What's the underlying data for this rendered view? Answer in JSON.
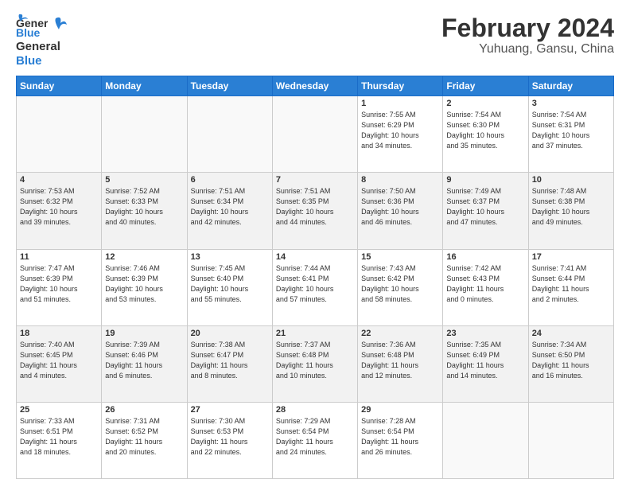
{
  "header": {
    "logo_general": "General",
    "logo_blue": "Blue",
    "main_title": "February 2024",
    "sub_title": "Yuhuang, Gansu, China"
  },
  "weekdays": [
    "Sunday",
    "Monday",
    "Tuesday",
    "Wednesday",
    "Thursday",
    "Friday",
    "Saturday"
  ],
  "weeks": [
    [
      {
        "day": "",
        "info": ""
      },
      {
        "day": "",
        "info": ""
      },
      {
        "day": "",
        "info": ""
      },
      {
        "day": "",
        "info": ""
      },
      {
        "day": "1",
        "info": "Sunrise: 7:55 AM\nSunset: 6:29 PM\nDaylight: 10 hours\nand 34 minutes."
      },
      {
        "day": "2",
        "info": "Sunrise: 7:54 AM\nSunset: 6:30 PM\nDaylight: 10 hours\nand 35 minutes."
      },
      {
        "day": "3",
        "info": "Sunrise: 7:54 AM\nSunset: 6:31 PM\nDaylight: 10 hours\nand 37 minutes."
      }
    ],
    [
      {
        "day": "4",
        "info": "Sunrise: 7:53 AM\nSunset: 6:32 PM\nDaylight: 10 hours\nand 39 minutes."
      },
      {
        "day": "5",
        "info": "Sunrise: 7:52 AM\nSunset: 6:33 PM\nDaylight: 10 hours\nand 40 minutes."
      },
      {
        "day": "6",
        "info": "Sunrise: 7:51 AM\nSunset: 6:34 PM\nDaylight: 10 hours\nand 42 minutes."
      },
      {
        "day": "7",
        "info": "Sunrise: 7:51 AM\nSunset: 6:35 PM\nDaylight: 10 hours\nand 44 minutes."
      },
      {
        "day": "8",
        "info": "Sunrise: 7:50 AM\nSunset: 6:36 PM\nDaylight: 10 hours\nand 46 minutes."
      },
      {
        "day": "9",
        "info": "Sunrise: 7:49 AM\nSunset: 6:37 PM\nDaylight: 10 hours\nand 47 minutes."
      },
      {
        "day": "10",
        "info": "Sunrise: 7:48 AM\nSunset: 6:38 PM\nDaylight: 10 hours\nand 49 minutes."
      }
    ],
    [
      {
        "day": "11",
        "info": "Sunrise: 7:47 AM\nSunset: 6:39 PM\nDaylight: 10 hours\nand 51 minutes."
      },
      {
        "day": "12",
        "info": "Sunrise: 7:46 AM\nSunset: 6:39 PM\nDaylight: 10 hours\nand 53 minutes."
      },
      {
        "day": "13",
        "info": "Sunrise: 7:45 AM\nSunset: 6:40 PM\nDaylight: 10 hours\nand 55 minutes."
      },
      {
        "day": "14",
        "info": "Sunrise: 7:44 AM\nSunset: 6:41 PM\nDaylight: 10 hours\nand 57 minutes."
      },
      {
        "day": "15",
        "info": "Sunrise: 7:43 AM\nSunset: 6:42 PM\nDaylight: 10 hours\nand 58 minutes."
      },
      {
        "day": "16",
        "info": "Sunrise: 7:42 AM\nSunset: 6:43 PM\nDaylight: 11 hours\nand 0 minutes."
      },
      {
        "day": "17",
        "info": "Sunrise: 7:41 AM\nSunset: 6:44 PM\nDaylight: 11 hours\nand 2 minutes."
      }
    ],
    [
      {
        "day": "18",
        "info": "Sunrise: 7:40 AM\nSunset: 6:45 PM\nDaylight: 11 hours\nand 4 minutes."
      },
      {
        "day": "19",
        "info": "Sunrise: 7:39 AM\nSunset: 6:46 PM\nDaylight: 11 hours\nand 6 minutes."
      },
      {
        "day": "20",
        "info": "Sunrise: 7:38 AM\nSunset: 6:47 PM\nDaylight: 11 hours\nand 8 minutes."
      },
      {
        "day": "21",
        "info": "Sunrise: 7:37 AM\nSunset: 6:48 PM\nDaylight: 11 hours\nand 10 minutes."
      },
      {
        "day": "22",
        "info": "Sunrise: 7:36 AM\nSunset: 6:48 PM\nDaylight: 11 hours\nand 12 minutes."
      },
      {
        "day": "23",
        "info": "Sunrise: 7:35 AM\nSunset: 6:49 PM\nDaylight: 11 hours\nand 14 minutes."
      },
      {
        "day": "24",
        "info": "Sunrise: 7:34 AM\nSunset: 6:50 PM\nDaylight: 11 hours\nand 16 minutes."
      }
    ],
    [
      {
        "day": "25",
        "info": "Sunrise: 7:33 AM\nSunset: 6:51 PM\nDaylight: 11 hours\nand 18 minutes."
      },
      {
        "day": "26",
        "info": "Sunrise: 7:31 AM\nSunset: 6:52 PM\nDaylight: 11 hours\nand 20 minutes."
      },
      {
        "day": "27",
        "info": "Sunrise: 7:30 AM\nSunset: 6:53 PM\nDaylight: 11 hours\nand 22 minutes."
      },
      {
        "day": "28",
        "info": "Sunrise: 7:29 AM\nSunset: 6:54 PM\nDaylight: 11 hours\nand 24 minutes."
      },
      {
        "day": "29",
        "info": "Sunrise: 7:28 AM\nSunset: 6:54 PM\nDaylight: 11 hours\nand 26 minutes."
      },
      {
        "day": "",
        "info": ""
      },
      {
        "day": "",
        "info": ""
      }
    ]
  ]
}
